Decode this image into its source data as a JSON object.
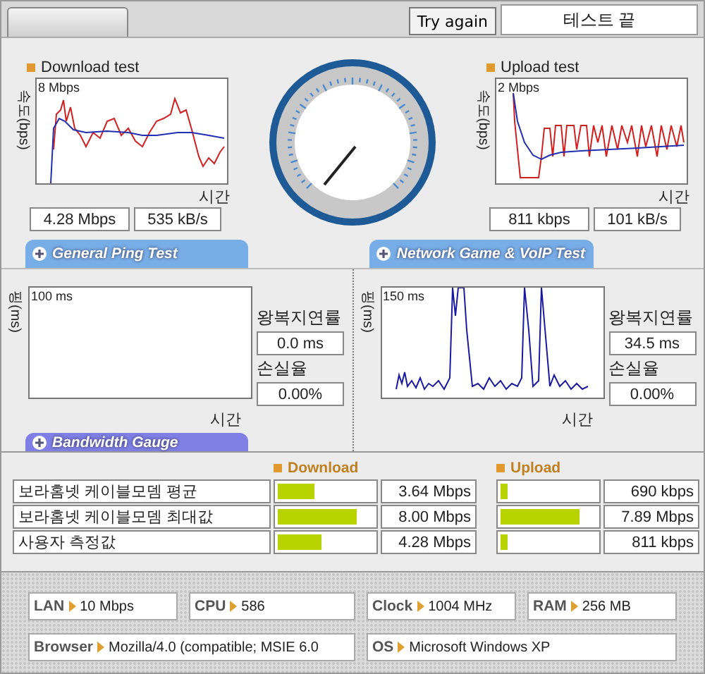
{
  "toolbar": {
    "button": "Try again",
    "status": "테스트 끝"
  },
  "speed_tests": [
    {
      "title": "Download test",
      "y_axis": "속도(bps)",
      "scale": "8 Mbps",
      "x_axis": "시간",
      "readings": [
        "4.28 Mbps",
        "535 kB/s"
      ]
    },
    {
      "title": "Upload test",
      "y_axis": "속도(bps)",
      "scale": "2 Mbps",
      "x_axis": "시간",
      "readings": [
        "811 kbps",
        "101 kB/s"
      ]
    }
  ],
  "ping_tests": [
    {
      "tab": "General Ping Test",
      "y_axis": "핑(ms)",
      "scale": "100 ms",
      "x_axis": "시간",
      "latency_label": "왕복지연률",
      "latency": "0.0 ms",
      "loss_label": "손실율",
      "loss": "0.00%"
    },
    {
      "tab": "Network Game & VoIP Test",
      "y_axis": "핑(ms)",
      "scale": "150 ms",
      "x_axis": "시간",
      "latency_label": "왕복지연률",
      "latency": "34.5 ms",
      "loss_label": "손실율",
      "loss": "0.00%"
    }
  ],
  "bandwidth": {
    "tab": "Bandwidth Gauge",
    "columns": [
      "Download",
      "Upload"
    ],
    "rows": [
      {
        "name": "보라홈넷 케이블모뎀 평균",
        "download": {
          "level": 0.38,
          "value": "3.64 Mbps"
        },
        "upload": {
          "level": 0.07,
          "value": "690 kbps"
        }
      },
      {
        "name": "보라홈넷 케이블모뎀 최대값",
        "download": {
          "level": 0.83,
          "value": "8.00 Mbps"
        },
        "upload": {
          "level": 0.82,
          "value": "7.89 Mbps"
        }
      },
      {
        "name": "사용자 측정값",
        "download": {
          "level": 0.45,
          "value": "4.28 Mbps"
        },
        "upload": {
          "level": 0.08,
          "value": "811 kbps"
        }
      }
    ]
  },
  "system_info": [
    {
      "label": "LAN",
      "value": "10 Mbps"
    },
    {
      "label": "CPU",
      "value": "586"
    },
    {
      "label": "Clock",
      "value": "1004 MHz"
    },
    {
      "label": "RAM",
      "value": "256 MB"
    },
    {
      "label": "Browser",
      "value": "Mozilla/4.0 (compatible; MSIE 6.0"
    },
    {
      "label": "OS",
      "value": "Microsoft Windows XP"
    }
  ]
}
